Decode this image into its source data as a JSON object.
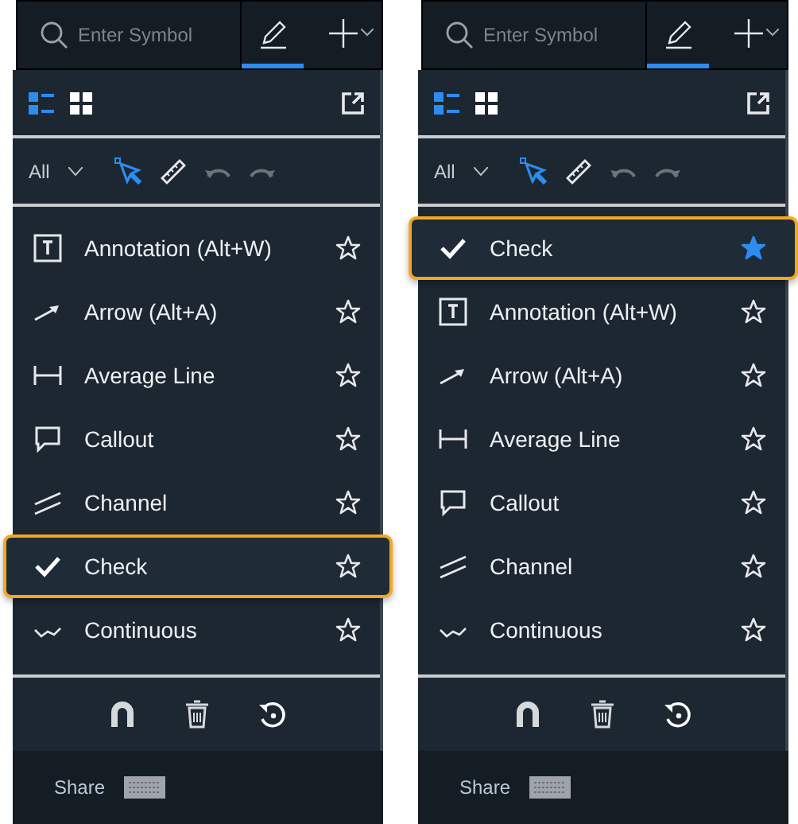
{
  "panels": [
    {
      "search": {
        "placeholder": "Enter Symbol"
      },
      "modes": [
        {
          "kind": "pencil",
          "selected": true
        },
        {
          "kind": "crosshair",
          "selected": false
        }
      ],
      "view": [
        {
          "kind": "list",
          "selected": true
        },
        {
          "kind": "grid",
          "selected": false
        }
      ],
      "filter": "All",
      "tools": [
        {
          "kind": "pointer",
          "selected": true
        },
        {
          "kind": "ruler",
          "selected": false
        },
        {
          "kind": "undo",
          "selected": false
        },
        {
          "kind": "redo",
          "selected": false
        }
      ],
      "items": [
        {
          "kind": "annotation",
          "label": "Annotation (Alt+W)",
          "favorite": false,
          "highlighted": false
        },
        {
          "kind": "arrow",
          "label": "Arrow (Alt+A)",
          "favorite": false,
          "highlighted": false
        },
        {
          "kind": "average",
          "label": "Average Line",
          "favorite": false,
          "highlighted": false
        },
        {
          "kind": "callout",
          "label": "Callout",
          "favorite": false,
          "highlighted": false
        },
        {
          "kind": "channel",
          "label": "Channel",
          "favorite": false,
          "highlighted": false
        },
        {
          "kind": "check",
          "label": "Check",
          "favorite": false,
          "highlighted": true
        },
        {
          "kind": "continuous",
          "label": "Continuous",
          "favorite": false,
          "highlighted": false
        }
      ],
      "footer": "Share"
    },
    {
      "search": {
        "placeholder": "Enter Symbol"
      },
      "modes": [
        {
          "kind": "pencil",
          "selected": true
        },
        {
          "kind": "crosshair",
          "selected": false
        }
      ],
      "view": [
        {
          "kind": "list",
          "selected": true
        },
        {
          "kind": "grid",
          "selected": false
        }
      ],
      "filter": "All",
      "tools": [
        {
          "kind": "pointer",
          "selected": true
        },
        {
          "kind": "ruler",
          "selected": false
        },
        {
          "kind": "undo",
          "selected": false
        },
        {
          "kind": "redo",
          "selected": false
        }
      ],
      "items": [
        {
          "kind": "check",
          "label": "Check",
          "favorite": true,
          "highlighted": true
        },
        {
          "kind": "annotation",
          "label": "Annotation (Alt+W)",
          "favorite": false,
          "highlighted": false
        },
        {
          "kind": "arrow",
          "label": "Arrow (Alt+A)",
          "favorite": false,
          "highlighted": false
        },
        {
          "kind": "average",
          "label": "Average Line",
          "favorite": false,
          "highlighted": false
        },
        {
          "kind": "callout",
          "label": "Callout",
          "favorite": false,
          "highlighted": false
        },
        {
          "kind": "channel",
          "label": "Channel",
          "favorite": false,
          "highlighted": false
        },
        {
          "kind": "continuous",
          "label": "Continuous",
          "favorite": false,
          "highlighted": false
        }
      ],
      "footer": "Share"
    }
  ]
}
